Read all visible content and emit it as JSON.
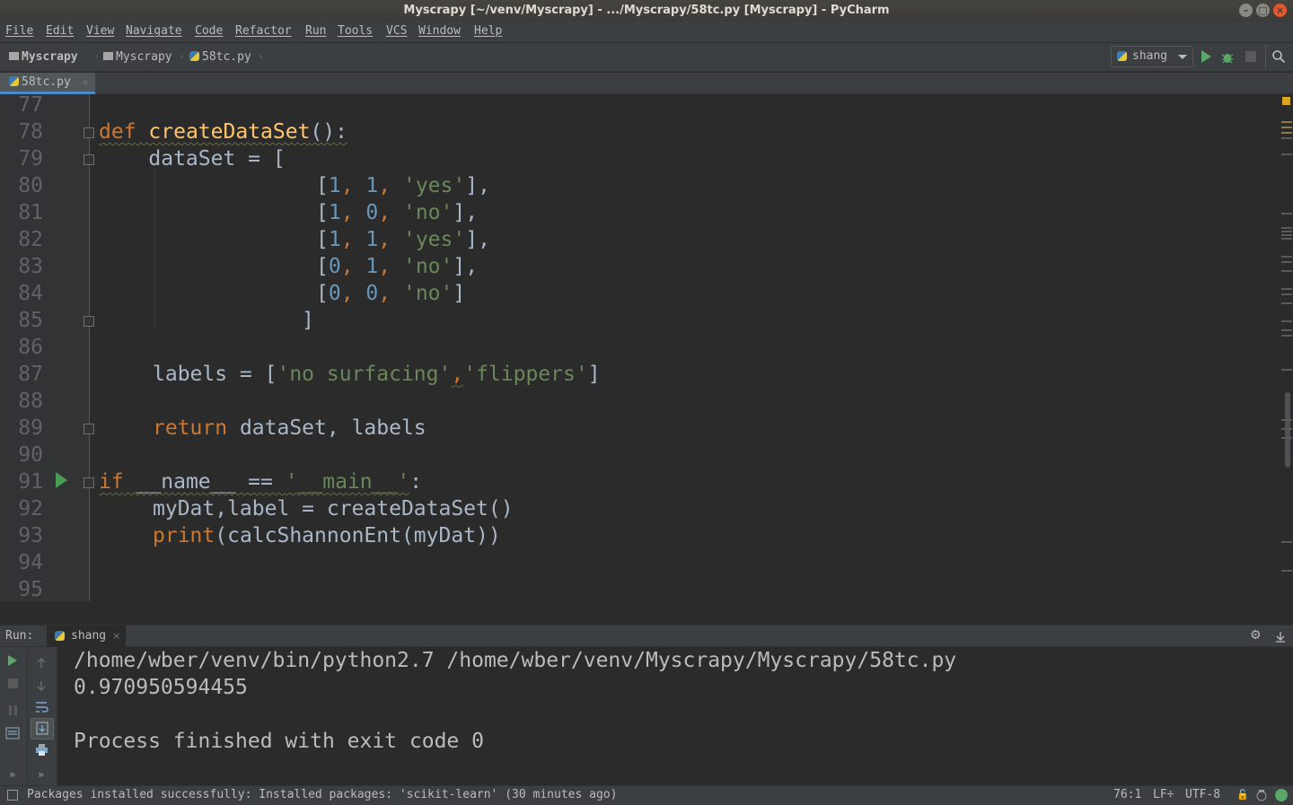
{
  "window": {
    "title": "Myscrapy [~/venv/Myscrapy] - .../Myscrapy/58tc.py [Myscrapy] - PyCharm",
    "controls": [
      "–",
      "□",
      "×"
    ]
  },
  "menu": [
    "File",
    "Edit",
    "View",
    "Navigate",
    "Code",
    "Refactor",
    "Run",
    "Tools",
    "VCS",
    "Window",
    "Help"
  ],
  "breadcrumb": {
    "project": "Myscrapy",
    "folder": "Myscrapy",
    "file": "58tc.py"
  },
  "run_config": {
    "name": "shang"
  },
  "editor_tab": {
    "label": "58tc.py",
    "close": "×"
  },
  "editor": {
    "line_numbers": [
      "77",
      "78",
      "79",
      "80",
      "81",
      "82",
      "83",
      "84",
      "85",
      "86",
      "87",
      "88",
      "89",
      "90",
      "91",
      "92",
      "93",
      "94",
      "95"
    ],
    "code": {
      "l78_kw": "def",
      "l78_fn": "createDataSet",
      "l78_rest": "():",
      "l79": "    dataSet = [",
      "l80_a": "[",
      "l80_n1": "1",
      "l80_c1": ", ",
      "l80_n2": "1",
      "l80_c2": ", ",
      "l80_s": "'yes'",
      "l80_e": "],",
      "l81_a": "[",
      "l81_n1": "1",
      "l81_c1": ", ",
      "l81_n2": "0",
      "l81_c2": ", ",
      "l81_s": "'no'",
      "l81_e": "],",
      "l82_a": "[",
      "l82_n1": "1",
      "l82_c1": ", ",
      "l82_n2": "1",
      "l82_c2": ", ",
      "l82_s": "'yes'",
      "l82_e": "],",
      "l83_a": "[",
      "l83_n1": "0",
      "l83_c1": ", ",
      "l83_n2": "1",
      "l83_c2": ", ",
      "l83_s": "'no'",
      "l83_e": "],",
      "l84_a": "[",
      "l84_n1": "0",
      "l84_c1": ", ",
      "l84_n2": "0",
      "l84_c2": ", ",
      "l84_s": "'no'",
      "l84_e": "]",
      "l85": "]",
      "l87_a": "labels = [",
      "l87_s1": "'no surfacing'",
      "l87_c": ",",
      "l87_s2": "'flippers'",
      "l87_e": "]",
      "l89_kw": "return",
      "l89_rest": " dataSet, labels",
      "l91_kw": "if",
      "l91_a": " __name__ == ",
      "l91_s": "'__main__'",
      "l91_e": ":",
      "l92": "myDat,label = createDataSet()",
      "l93_kw": "print",
      "l93_rest": "(calcShannonEnt(myDat))"
    }
  },
  "run": {
    "header_label": "Run:",
    "tab_label": "shang",
    "output": [
      "/home/wber/venv/bin/python2.7 /home/wber/venv/Myscrapy/Myscrapy/58tc.py",
      "0.970950594455",
      "",
      "Process finished with exit code 0"
    ]
  },
  "status": {
    "message": "Packages installed successfully: Installed packages: 'scikit-learn' (30 minutes ago)",
    "position": "76:1",
    "line_sep": "LF÷",
    "encoding": "UTF-8"
  },
  "colors": {
    "keyword": "#cc7832",
    "function": "#ffc66d",
    "number": "#6897bb",
    "string": "#6a8759",
    "run_green": "#59a869",
    "tab_accent": "#4a88c7"
  },
  "icons": [
    "folder-icon",
    "python-file-icon",
    "run-icon",
    "debug-icon",
    "stop-icon",
    "search-icon",
    "settings-icon",
    "lock-icon",
    "event-log-icon"
  ]
}
